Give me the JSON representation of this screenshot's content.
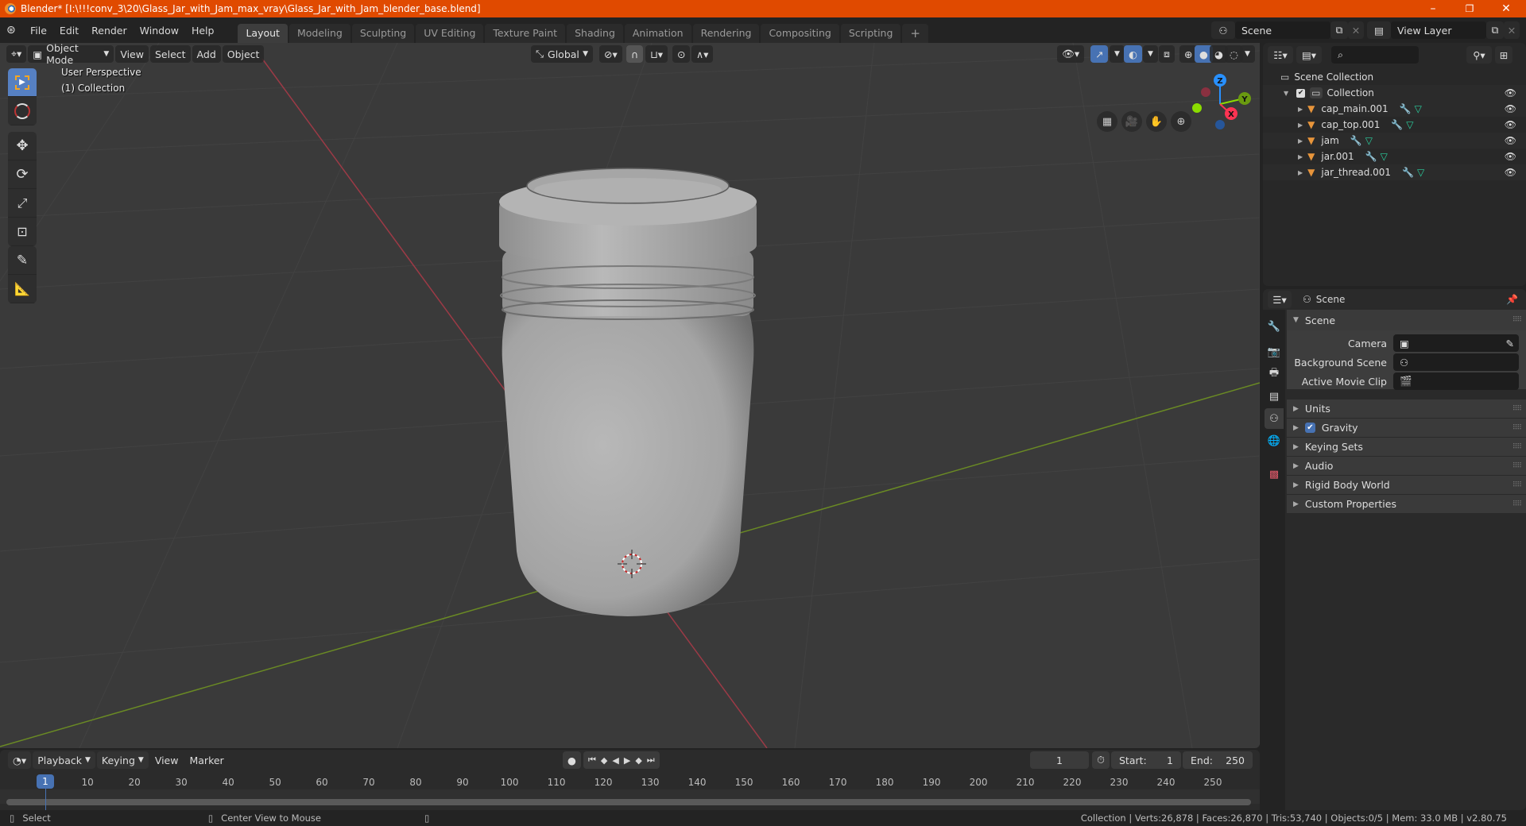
{
  "window": {
    "title": "Blender* [I:\\!!!conv_3\\20\\Glass_Jar_with_Jam_max_vray\\Glass_Jar_with_Jam_blender_base.blend]",
    "controls": {
      "minimize": "–",
      "maximize": "❐",
      "close": "✕"
    }
  },
  "menubar": {
    "items": [
      "File",
      "Edit",
      "Render",
      "Window",
      "Help"
    ]
  },
  "workspaces": {
    "tabs": [
      "Layout",
      "Modeling",
      "Sculpting",
      "UV Editing",
      "Texture Paint",
      "Shading",
      "Animation",
      "Rendering",
      "Compositing",
      "Scripting"
    ],
    "active": "Layout",
    "add_label": "+"
  },
  "scene_selector": {
    "value": "Scene"
  },
  "view_layer_selector": {
    "value": "View Layer"
  },
  "viewport_header": {
    "mode": "Object Mode",
    "menus": [
      "View",
      "Select",
      "Add",
      "Object"
    ],
    "transform_orientation": "Global"
  },
  "viewport": {
    "overlay_line1": "User Perspective",
    "overlay_line2": "(1) Collection",
    "gizmo": {
      "x": "X",
      "y": "Y",
      "z": "Z"
    },
    "axis_colors": {
      "x": "#ff3352",
      "y": "#8bdc00",
      "z": "#2890ff"
    }
  },
  "outliner": {
    "search_placeholder": "",
    "root": "Scene Collection",
    "collection": "Collection",
    "objects": [
      {
        "name": "cap_main.001"
      },
      {
        "name": "cap_top.001"
      },
      {
        "name": "jam"
      },
      {
        "name": "jar.001"
      },
      {
        "name": "jar_thread.001"
      }
    ]
  },
  "properties": {
    "context": "Scene",
    "panel_title": "Scene",
    "fields": [
      {
        "label": "Camera",
        "value": ""
      },
      {
        "label": "Background Scene",
        "value": ""
      },
      {
        "label": "Active Movie Clip",
        "value": ""
      }
    ],
    "subpanels": [
      {
        "label": "Units"
      },
      {
        "label": "Gravity",
        "checked": true
      },
      {
        "label": "Keying Sets"
      },
      {
        "label": "Audio"
      },
      {
        "label": "Rigid Body World"
      },
      {
        "label": "Custom Properties"
      }
    ]
  },
  "timeline": {
    "menus": [
      "Playback",
      "Keying",
      "View",
      "Marker"
    ],
    "current_frame": "1",
    "start_label": "Start:",
    "start": "1",
    "end_label": "End:",
    "end": "250",
    "ticks": [
      "10",
      "20",
      "30",
      "40",
      "50",
      "60",
      "70",
      "80",
      "90",
      "100",
      "110",
      "120",
      "130",
      "140",
      "150",
      "160",
      "170",
      "180",
      "190",
      "200",
      "210",
      "220",
      "230",
      "240",
      "250"
    ],
    "playhead": "1"
  },
  "statusbar": {
    "left_action": "Select",
    "middle_action": "Center View to Mouse",
    "stats": "Collection | Verts:26,878 | Faces:26,870 | Tris:53,740 | Objects:0/5 | Mem: 33.0 MB | v2.80.75"
  }
}
